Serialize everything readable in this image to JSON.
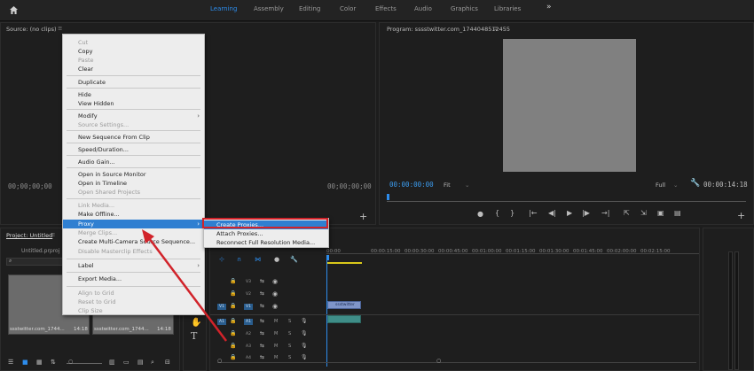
{
  "workspace_tabs": [
    "Learning",
    "Assembly",
    "Editing",
    "Color",
    "Effects",
    "Audio",
    "Graphics",
    "Libraries"
  ],
  "workspace_active": "Learning",
  "more_tabs_glyph": "»",
  "source_panel": {
    "title": "Source: (no clips)",
    "timecode_in": "00;00;00;00",
    "timecode_out": "00;00;00;00"
  },
  "program_panel": {
    "title": "Program: sssstwitter.com_1744048512455",
    "timecode": "00:00:00:00",
    "fit": "Fit",
    "quality": "Full",
    "duration": "00:00:14:18"
  },
  "project_panel": {
    "tab": "Project: Untitled",
    "file": "Untitled.prproj",
    "items": [
      {
        "name": "ssstwitter.com_1744...",
        "duration": "14:18"
      },
      {
        "name": "ssstwitter.com_1744...",
        "duration": "14:18"
      }
    ]
  },
  "context_menu": {
    "items": [
      {
        "label": "Cut",
        "disabled": true
      },
      {
        "label": "Copy",
        "disabled": false
      },
      {
        "label": "Paste",
        "disabled": true
      },
      {
        "label": "Clear",
        "disabled": false
      },
      {
        "label": "Duplicate",
        "disabled": false
      },
      {
        "label": "Hide",
        "disabled": false
      },
      {
        "label": "View Hidden",
        "disabled": false
      },
      {
        "label": "Modify",
        "disabled": false,
        "submenu": true
      },
      {
        "label": "Source Settings...",
        "disabled": true
      },
      {
        "label": "New Sequence From Clip",
        "disabled": false
      },
      {
        "label": "Speed/Duration...",
        "disabled": false
      },
      {
        "label": "Audio Gain...",
        "disabled": false
      },
      {
        "label": "Open in Source Monitor",
        "disabled": false
      },
      {
        "label": "Open in Timeline",
        "disabled": false
      },
      {
        "label": "Open Shared Projects",
        "disabled": true
      },
      {
        "label": "Link Media...",
        "disabled": true
      },
      {
        "label": "Make Offline...",
        "disabled": false
      },
      {
        "label": "Proxy",
        "disabled": false,
        "submenu": true,
        "highlighted": true
      },
      {
        "label": "Merge Clips...",
        "disabled": true
      },
      {
        "label": "Create Multi-Camera Source Sequence...",
        "disabled": false
      },
      {
        "label": "Disable Masterclip Effects",
        "disabled": true
      },
      {
        "label": "Label",
        "disabled": false,
        "submenu": true
      },
      {
        "label": "Export Media...",
        "disabled": false
      },
      {
        "label": "Align to Grid",
        "disabled": true
      },
      {
        "label": "Reset to Grid",
        "disabled": true
      },
      {
        "label": "Clip Size",
        "disabled": true
      }
    ]
  },
  "proxy_submenu": {
    "items": [
      "Create Proxies...",
      "Attach Proxies...",
      "Reconnect Full Resolution Media..."
    ],
    "highlighted": "Create Proxies..."
  },
  "timeline": {
    "ruler": [
      "00:00",
      "00:00:15:00",
      "00:00:30:00",
      "00:00:45:00",
      "00:01:00:00",
      "00:01:15:00",
      "00:01:30:00",
      "00:01:45:00",
      "00:02:00:00",
      "00:02:15:00"
    ],
    "video_tracks": [
      "V3",
      "V2",
      "V1"
    ],
    "audio_tracks": [
      "A1",
      "A2",
      "A3",
      "A4"
    ],
    "src_video": "V1",
    "src_audio": "A1",
    "clip_label": "ssstwitter"
  },
  "colors": {
    "accent": "#2d8ceb",
    "highlight": "#2f7fd1",
    "annotation": "#d1232a"
  }
}
